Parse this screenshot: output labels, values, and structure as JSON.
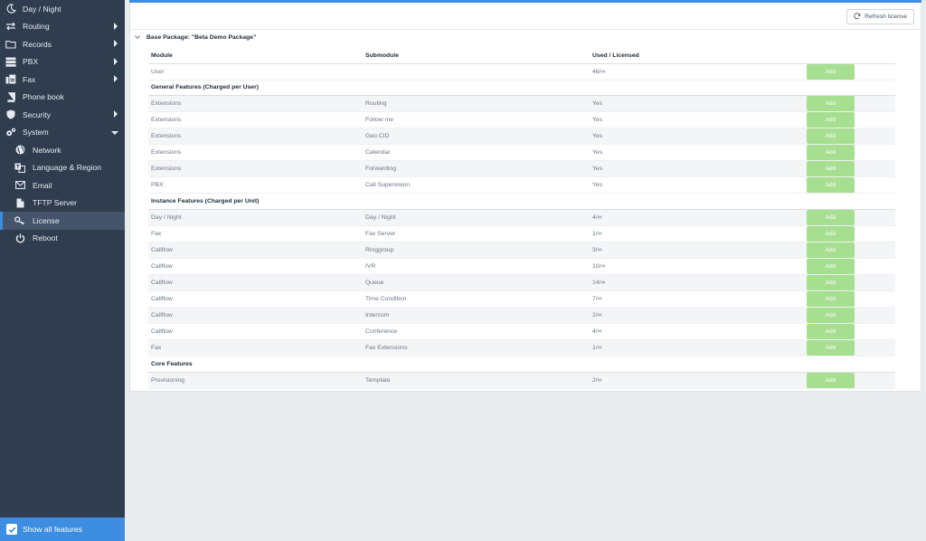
{
  "sidebar": {
    "items": [
      {
        "label": "Day / Night",
        "icon": "moon-icon",
        "has_children": false
      },
      {
        "label": "Routing",
        "icon": "arrows-icon",
        "has_children": true
      },
      {
        "label": "Records",
        "icon": "folder-icon",
        "has_children": true
      },
      {
        "label": "PBX",
        "icon": "server-icon",
        "has_children": true
      },
      {
        "label": "Fax",
        "icon": "fax-icon",
        "has_children": true
      },
      {
        "label": "Phone book",
        "icon": "book-icon",
        "has_children": false
      },
      {
        "label": "Security",
        "icon": "shield-icon",
        "has_children": true
      },
      {
        "label": "System",
        "icon": "gears-icon",
        "has_children": true,
        "expanded": true
      }
    ],
    "system_children": [
      {
        "label": "Network",
        "icon": "globe-icon"
      },
      {
        "label": "Language & Region",
        "icon": "language-icon"
      },
      {
        "label": "Email",
        "icon": "envelope-icon"
      },
      {
        "label": "TFTP Server",
        "icon": "file-icon"
      },
      {
        "label": "License",
        "icon": "key-icon",
        "active": true
      },
      {
        "label": "Reboot",
        "icon": "power-icon"
      }
    ],
    "footer_label": "Show all features",
    "footer_checked": true
  },
  "main": {
    "refresh_label": "Refresh license",
    "package_title": "Base Package: \"Beta Demo Package\"",
    "columns": [
      "Module",
      "Submodule",
      "Used / Licensed"
    ],
    "add_label": "Add",
    "rows": [
      {
        "type": "row",
        "module": "User",
        "submodule": "",
        "used": "46/∞"
      },
      {
        "type": "section",
        "label": "General Features (Charged per User)"
      },
      {
        "type": "row",
        "module": "Extensions",
        "submodule": "Routing",
        "used": "Yes"
      },
      {
        "type": "row",
        "module": "Extensions",
        "submodule": "Follow me",
        "used": "Yes"
      },
      {
        "type": "row",
        "module": "Extensions",
        "submodule": "Geo CID",
        "used": "Yes"
      },
      {
        "type": "row",
        "module": "Extensions",
        "submodule": "Calendar",
        "used": "Yes"
      },
      {
        "type": "row",
        "module": "Extensions",
        "submodule": "Forwarding",
        "used": "Yes"
      },
      {
        "type": "row",
        "module": "PBX",
        "submodule": "Call Supervision",
        "used": "Yes"
      },
      {
        "type": "section",
        "label": "Instance Features (Charged per Unit)"
      },
      {
        "type": "row",
        "module": "Day / Night",
        "submodule": "Day / Night",
        "used": "4/∞"
      },
      {
        "type": "row",
        "module": "Fax",
        "submodule": "Fax Server",
        "used": "1/∞"
      },
      {
        "type": "row",
        "module": "Callflow",
        "submodule": "Ringgroup",
        "used": "3/∞"
      },
      {
        "type": "row",
        "module": "Callflow",
        "submodule": "IVR",
        "used": "10/∞"
      },
      {
        "type": "row",
        "module": "Callflow",
        "submodule": "Queue",
        "used": "14/∞"
      },
      {
        "type": "row",
        "module": "Callflow",
        "submodule": "Time Condition",
        "used": "7/∞"
      },
      {
        "type": "row",
        "module": "Callflow",
        "submodule": "Intercom",
        "used": "2/∞"
      },
      {
        "type": "row",
        "module": "Callflow",
        "submodule": "Conference",
        "used": "4/∞"
      },
      {
        "type": "row",
        "module": "Fax",
        "submodule": "Fax Extensions",
        "used": "1/∞"
      },
      {
        "type": "section",
        "label": "Core Features"
      },
      {
        "type": "row",
        "module": "Provisioning",
        "submodule": "Template",
        "used": "2/∞"
      }
    ]
  },
  "colors": {
    "sidebar": "#2f3d4f",
    "accent": "#3d8de0",
    "add_button": "#a6df8f"
  }
}
